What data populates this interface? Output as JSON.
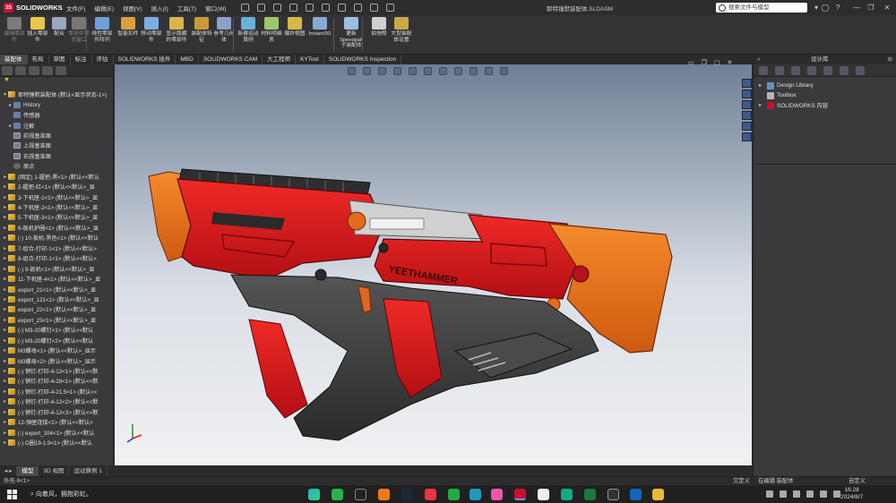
{
  "app": {
    "name": "SOLIDWORKS",
    "doc_title": "耶特锤默装配体.SLDASM"
  },
  "menu": [
    "文件(F)",
    "编辑(E)",
    "视图(V)",
    "插入(I)",
    "工具(T)",
    "窗口(W)"
  ],
  "search": {
    "placeholder": "搜索文件与模型"
  },
  "ribbon": [
    {
      "label": "编辑零部件",
      "dim": true
    },
    {
      "label": "插入零部件"
    },
    {
      "label": "配合"
    },
    {
      "label": "零部件预览窗口",
      "dim": true
    },
    {
      "label": "线性零部件阵列"
    },
    {
      "label": "智能扣件"
    },
    {
      "label": "移动零部件"
    },
    {
      "label": "显示隐藏的零部件"
    },
    {
      "label": "装配体特征"
    },
    {
      "label": "参考几何体"
    },
    {
      "label": "新建运动算例"
    },
    {
      "label": "材料明细表"
    },
    {
      "label": "爆炸视图"
    },
    {
      "label": "Instant3D"
    },
    {
      "label": "更新Speedpak子装配体"
    },
    {
      "label": "拍快照"
    },
    {
      "label": "大型装配体设置"
    }
  ],
  "tabs": [
    "装配体",
    "布局",
    "草图",
    "标注",
    "评估",
    "SOLIDWORKS 插件",
    "MBD",
    "SOLIDWORKS CAM",
    "大工程师",
    "KYTool",
    "SOLIDWORKS Inspection"
  ],
  "active_tab": "装配体",
  "tree": [
    {
      "label": "耶特锤默装配体 (默认<显示状态-1>)",
      "type": "asm",
      "ex": "▾",
      "indent": 0
    },
    {
      "label": "History",
      "type": "folder",
      "ex": "▸",
      "indent": 1
    },
    {
      "label": "传感器",
      "type": "folder",
      "ex": "",
      "indent": 1
    },
    {
      "label": "注解",
      "type": "folder",
      "ex": "▸",
      "indent": 1
    },
    {
      "label": "前视基准面",
      "type": "plane",
      "ex": "",
      "indent": 1
    },
    {
      "label": "上视基准面",
      "type": "plane",
      "ex": "",
      "indent": 1
    },
    {
      "label": "右视基准面",
      "type": "plane",
      "ex": "",
      "indent": 1
    },
    {
      "label": "原点",
      "type": "origin",
      "ex": "",
      "indent": 1
    },
    {
      "label": "(固定) 1-握把-黑<1> (默认<<默认",
      "type": "part",
      "ex": "▸",
      "indent": 0
    },
    {
      "label": "2-握把-红<1> (默认<<默认>_显",
      "type": "part",
      "ex": "▸",
      "indent": 0
    },
    {
      "label": "3-下机匣-1<1> (默认<<默认>_显",
      "type": "part",
      "ex": "▸",
      "indent": 0
    },
    {
      "label": "4-下机匣-2<1> (默认<<默认>_显",
      "type": "part",
      "ex": "▸",
      "indent": 0
    },
    {
      "label": "5-下机匣-3<1> (默认<<默认>_显",
      "type": "part",
      "ex": "▸",
      "indent": 0
    },
    {
      "label": "6-板机护圈<1> (默认<<默认>_显",
      "type": "part",
      "ex": "▸",
      "indent": 0
    },
    {
      "label": "(-) 10-扳机-黑色<1> (默认<<默认",
      "type": "part",
      "ex": "▸",
      "indent": 0
    },
    {
      "label": "7-组合-打印-1<1> (默认<<默认>",
      "type": "part",
      "ex": "▸",
      "indent": 0
    },
    {
      "label": "8-组合-打印-1<1> (默认<<默认>",
      "type": "part",
      "ex": "▸",
      "indent": 0
    },
    {
      "label": "(-) 9-扳机<1> (默认<<默认>_显",
      "type": "part",
      "ex": "▸",
      "indent": 0
    },
    {
      "label": "11-下机匣-4<1> (默认<<默认>_显",
      "type": "part",
      "ex": "▸",
      "indent": 0
    },
    {
      "label": "export_21<1> (默认<<默认>_显",
      "type": "part",
      "ex": "▸",
      "indent": 0
    },
    {
      "label": "export_121<1> (默认<<默认>_显",
      "type": "part",
      "ex": "▸",
      "indent": 0
    },
    {
      "label": "export_22<1> (默认<<默认>_显",
      "type": "part",
      "ex": "▸",
      "indent": 0
    },
    {
      "label": "export_23<1> (默认<<默认>_显",
      "type": "part",
      "ex": "▸",
      "indent": 0
    },
    {
      "label": "(-) M3-20螺钉<1> (默认<<默认",
      "type": "part",
      "ex": "▸",
      "indent": 0
    },
    {
      "label": "(-) M3-20螺钉<2> (默认<<默认",
      "type": "part",
      "ex": "▸",
      "indent": 0
    },
    {
      "label": "M3螺母<1> (默认<<默认>_显示",
      "type": "part",
      "ex": "▸",
      "indent": 0
    },
    {
      "label": "M3螺母<2> (默认<<默认>_显示",
      "type": "part",
      "ex": "▸",
      "indent": 0
    },
    {
      "label": "(-) 销钉-打印-4-12<1> (默认<<默",
      "type": "part",
      "ex": "▸",
      "indent": 0
    },
    {
      "label": "(-) 销钉-打印-4-28<1> (默认<<默",
      "type": "part",
      "ex": "▸",
      "indent": 0
    },
    {
      "label": "(-) 销钉-打印-4-21.5<1> (默认<<",
      "type": "part",
      "ex": "▸",
      "indent": 0
    },
    {
      "label": "(-) 销钉-打印-4-12<2> (默认<<默",
      "type": "part",
      "ex": "▸",
      "indent": 0
    },
    {
      "label": "(-) 销钉-打印-4-12<3> (默认<<默",
      "type": "part",
      "ex": "▸",
      "indent": 0
    },
    {
      "label": "12-弹匣连接<1> (默认<<默认>",
      "type": "part",
      "ex": "▸",
      "indent": 0
    },
    {
      "label": "(-) export_104<1> (默认<<默认",
      "type": "part",
      "ex": "▸",
      "indent": 0
    },
    {
      "label": "(-) O圈19-1.9<1> (默认<<默认",
      "type": "part",
      "ex": "▸",
      "indent": 0
    }
  ],
  "bottom_tabs": [
    "模型",
    "3D 视图",
    "运动算例 1"
  ],
  "active_bottom_tab": "模型",
  "statusbar": {
    "left": "外壳-9<1>",
    "mid1": "欠定义",
    "mid2": "在编辑 装配体",
    "right": "自定义"
  },
  "taskpane": {
    "title": "设计库",
    "items": [
      {
        "label": "Design Library",
        "ex": "▸"
      },
      {
        "label": "Toolbox",
        "ex": ""
      },
      {
        "label": "SOLIDWORKS 内容",
        "ex": "▸"
      }
    ]
  },
  "model": {
    "brand_text": "YEETHAMMER"
  },
  "taskbar": {
    "search_text": "向着风，拥抱彩虹。",
    "time": "16:28",
    "date": "2024/8/7"
  },
  "colors": {
    "accent_red": "#d4141c",
    "orange": "#e8701c",
    "dark_gray": "#3c3c3c"
  }
}
